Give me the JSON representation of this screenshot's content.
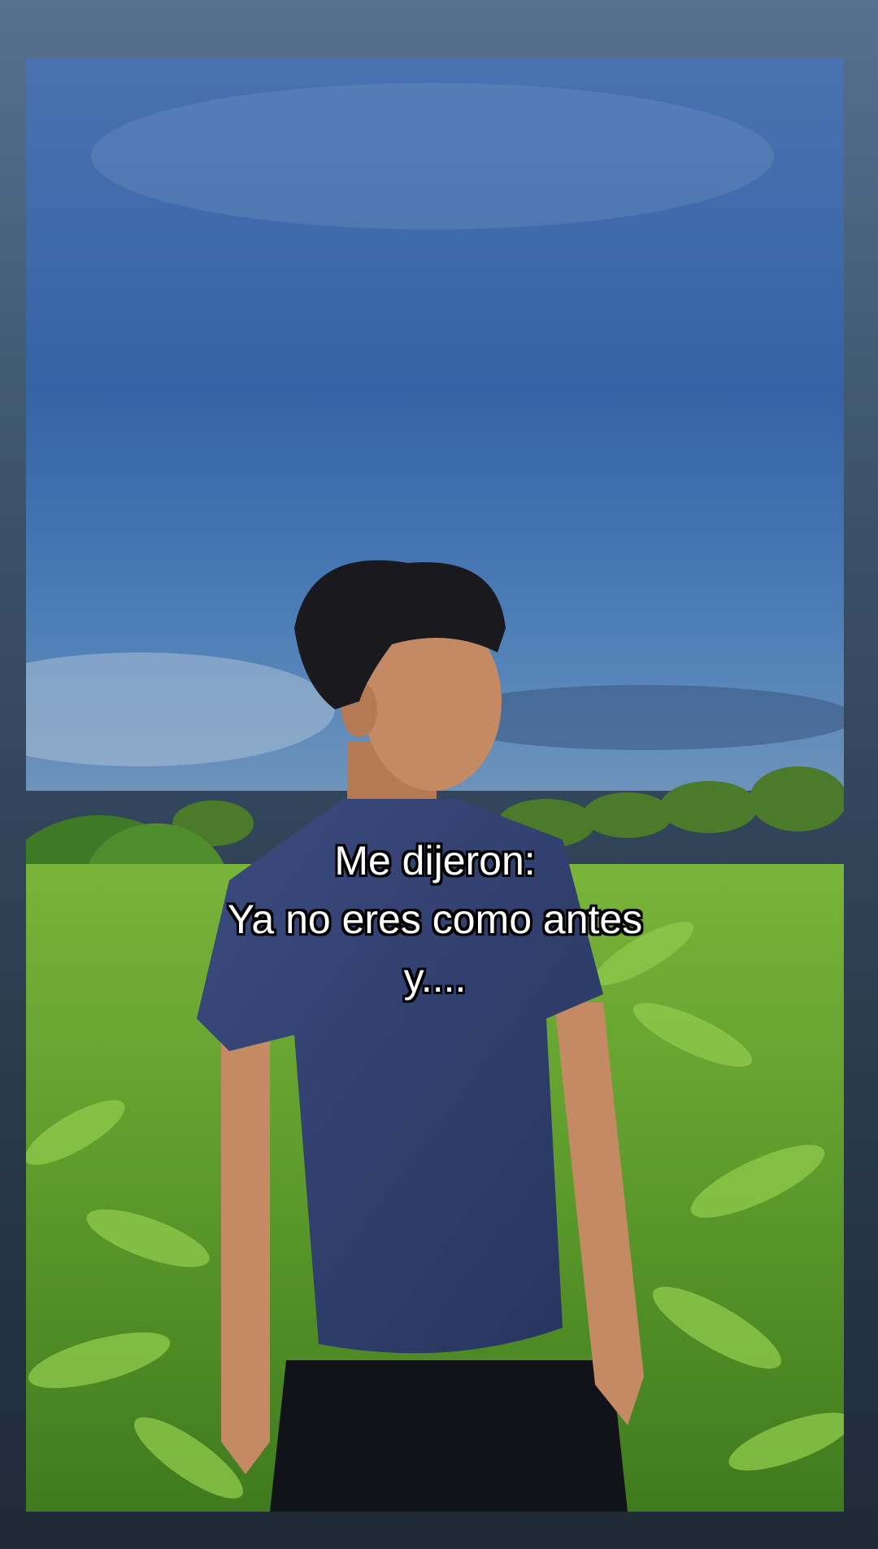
{
  "caption": {
    "lines": [
      "Me dijeron:",
      "Ya no eres como antes",
      "y...."
    ]
  },
  "colors": {
    "frame_top": "#56708f",
    "frame_bottom": "#1f2a36",
    "sky_top": "#3e6aa8",
    "sky_bottom": "#5a86b8",
    "foliage": "#5f9a2c",
    "shirt": "#2f3e6e",
    "shorts": "#111318",
    "skin": "#c48a64",
    "hair": "#1a1a1e"
  }
}
